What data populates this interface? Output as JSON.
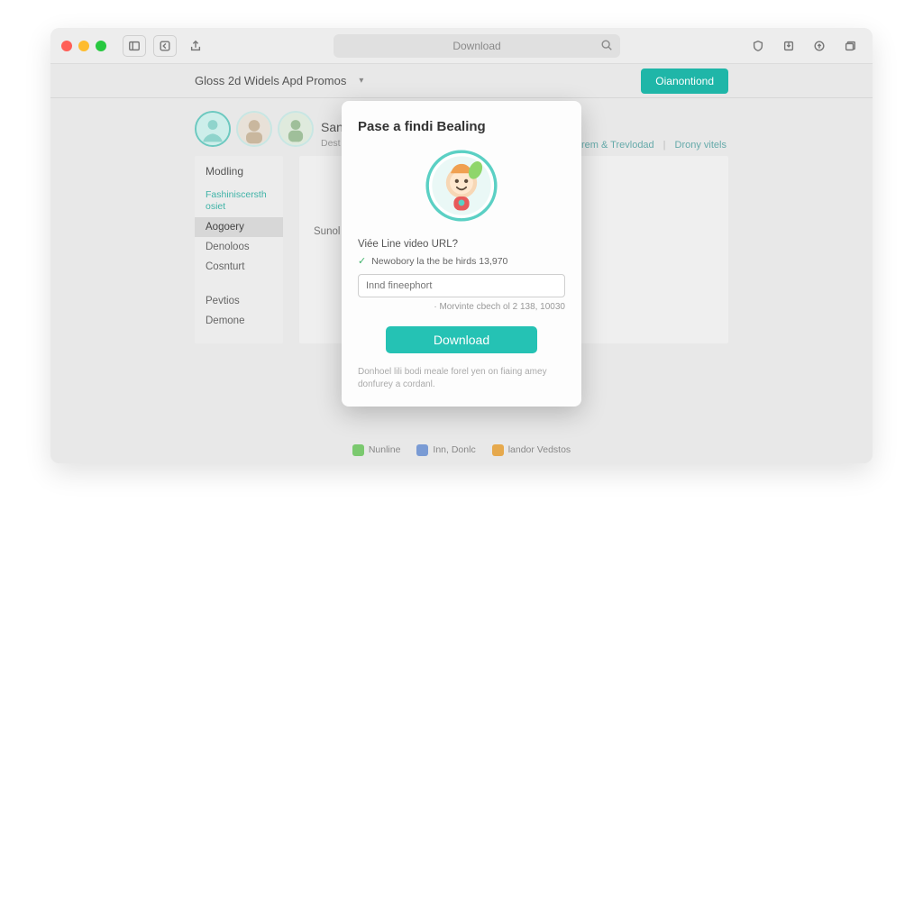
{
  "colors": {
    "traffic_red": "#ff5f57",
    "traffic_yellow": "#febc2e",
    "traffic_green": "#28c840",
    "teal": "#1fb6a8",
    "teal_btn": "#25c2b4"
  },
  "titlebar": {
    "search_placeholder": "Download"
  },
  "nav": {
    "title": "Gloss 2d Widels Apd Promos",
    "cta": "Oianontiond"
  },
  "header": {
    "title": "San",
    "subtitle": "Dest",
    "meta1": "rem & Trevlodad",
    "meta2": "Drony vitels"
  },
  "sidebar": {
    "heading": "Modling",
    "items": [
      {
        "label": "Fashiniscersth osiet",
        "teal": true
      },
      {
        "label": "Aogoery",
        "active": true
      },
      {
        "label": "Denoloos"
      },
      {
        "label": "Cosnturt"
      }
    ],
    "items2": [
      {
        "label": "Pevtios"
      },
      {
        "label": "Demone"
      }
    ]
  },
  "content": {
    "line1": "Sunol"
  },
  "modal": {
    "title": "Pase a findi Bealing",
    "label": "Viée Line video URL?",
    "check": "Newobory la the be hirds 13,970",
    "placeholder": "Innd fineephort",
    "hint": "· Morvinte cbech ol 2 138, 10030",
    "button": "Download",
    "footer": "Donhoel lili bodi meale forel yen on fiaing amey donfurey a cordanl."
  },
  "footer": {
    "f1": "Nunline",
    "f2": "Inn, Donlc",
    "f3": "landor Vedstos",
    "c1": "#7bc96f",
    "c2": "#7a9bd4",
    "c3": "#e6a94d"
  }
}
